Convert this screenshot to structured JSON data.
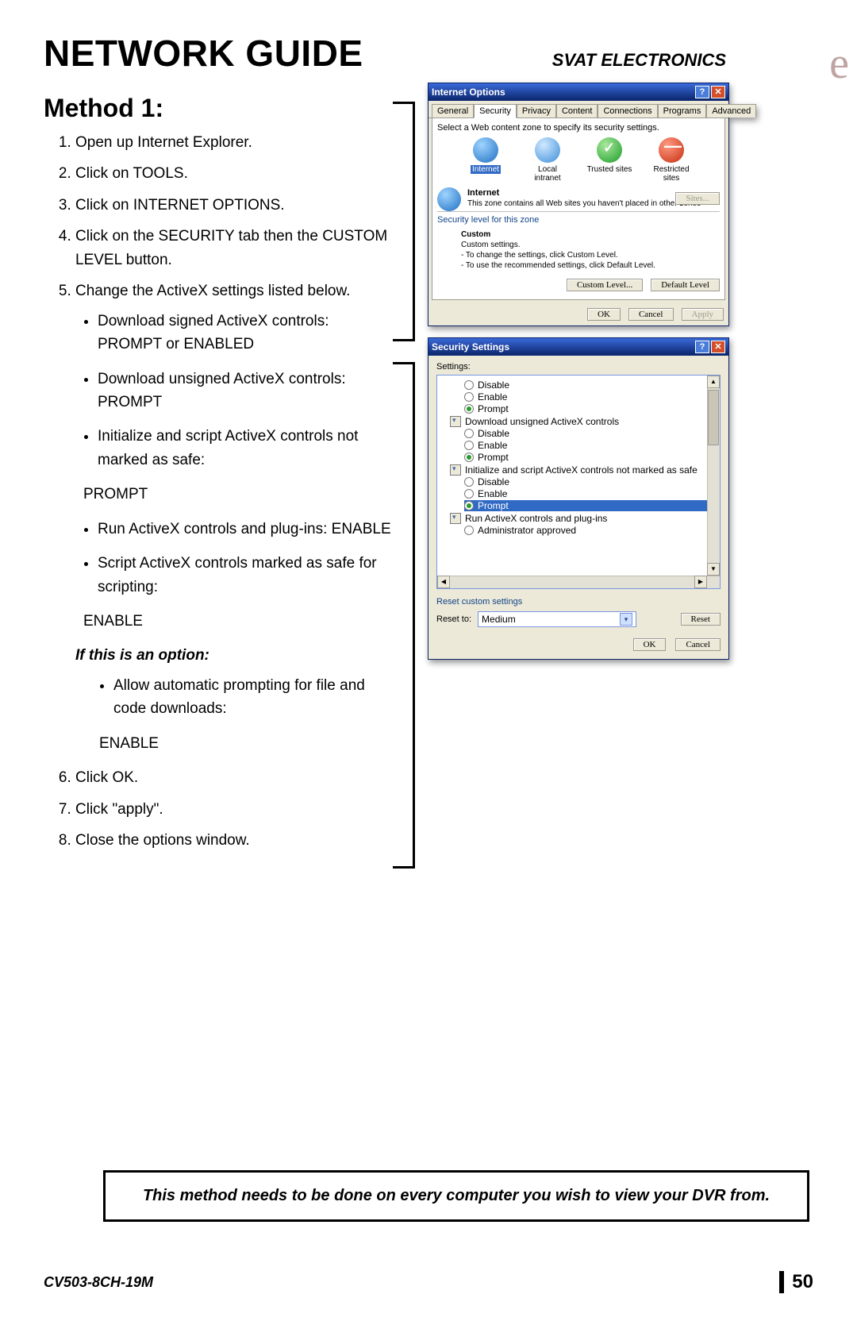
{
  "header": {
    "title": "NETWORK GUIDE",
    "brand": "SVAT ELECTRONICS",
    "util_letter": "e"
  },
  "method": {
    "heading": "Method 1:"
  },
  "steps": {
    "s1": "Open up Internet Explorer.",
    "s2": "Click on TOOLS.",
    "s3": "Click on INTERNET OPTIONS.",
    "s4": "Click on the SECURITY tab then the CUSTOM LEVEL button.",
    "s5": " Change the ActiveX settings listed below.",
    "s5_items": {
      "b1": "Download signed ActiveX controls: PROMPT or ENABLED",
      "b2": "Download unsigned ActiveX controls: PROMPT",
      "b3": "Initialize and script ActiveX controls not marked as safe:",
      "b3_val": "PROMPT",
      "b4": "Run ActiveX controls and plug-ins: ENABLE",
      "b5": "Script ActiveX controls marked as safe for scripting:",
      "b5_val": "ENABLE"
    },
    "if_option": "If this is an option:",
    "opt_b": "Allow automatic prompting for file and code downloads:",
    "opt_val": "ENABLE",
    "s6": "Click OK.",
    "s7": "Click \"apply\".",
    "s8": "Close the options window."
  },
  "dlg1": {
    "title": "Internet Options",
    "tabs": {
      "t1": "General",
      "t2": "Security",
      "t3": "Privacy",
      "t4": "Content",
      "t5": "Connections",
      "t6": "Programs",
      "t7": "Advanced"
    },
    "zone_prompt": "Select a Web content zone to specify its security settings.",
    "zones": {
      "z1": "Internet",
      "z2": "Local intranet",
      "z3": "Trusted sites",
      "z4": "Restricted sites"
    },
    "desc_title": "Internet",
    "desc_text": "This zone contains all Web sites you haven't placed in other zones",
    "sites_btn": "Sites...",
    "seclevel": "Security level for this zone",
    "custom": "Custom",
    "custom_l1": "Custom settings.",
    "custom_l2": "- To change the settings, click Custom Level.",
    "custom_l3": "- To use the recommended settings, click Default Level.",
    "btn_custom": "Custom Level...",
    "btn_default": "Default Level",
    "ok": "OK",
    "cancel": "Cancel",
    "apply": "Apply"
  },
  "dlg2": {
    "title": "Security Settings",
    "settings_label": "Settings:",
    "r_disable": "Disable",
    "r_enable": "Enable",
    "r_prompt": "Prompt",
    "grp1": "Download unsigned ActiveX controls",
    "grp2": "Initialize and script ActiveX controls not marked as safe",
    "grp3": "Run ActiveX controls and plug-ins",
    "admin": "Administrator approved",
    "reset_custom": "Reset custom settings",
    "reset_to": "Reset to:",
    "reset_val": "Medium",
    "reset_btn": "Reset",
    "ok": "OK",
    "cancel": "Cancel"
  },
  "note": "This method needs to be done on every computer you wish to view your DVR from.",
  "footer": {
    "model": "CV503-8CH-19M",
    "page": "50"
  }
}
